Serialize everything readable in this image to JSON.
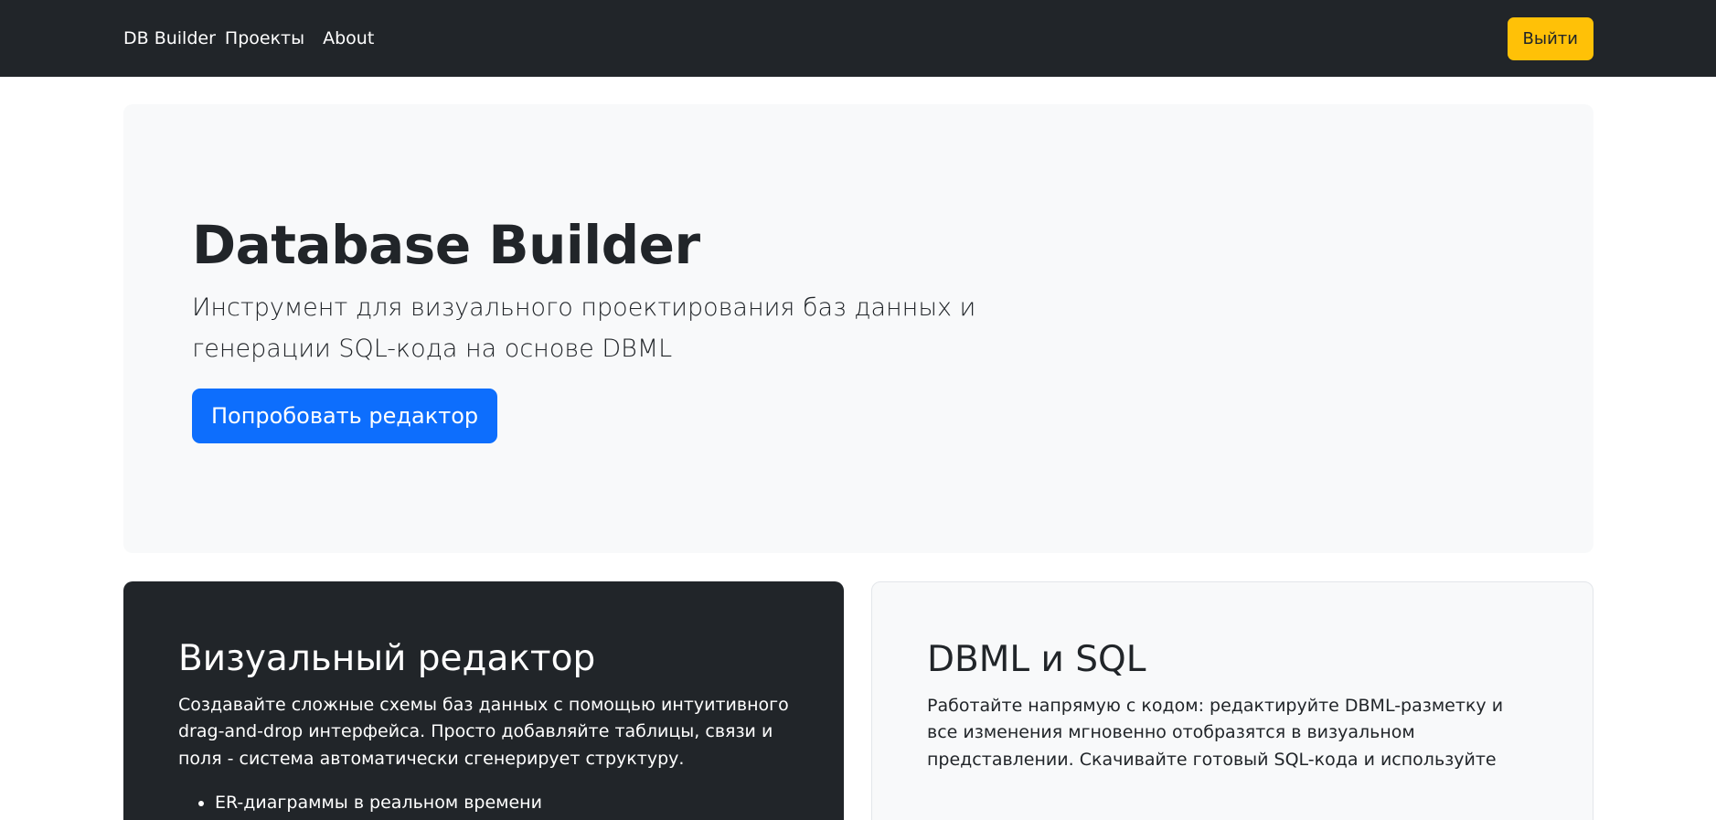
{
  "navbar": {
    "brand": "DB Builder",
    "links": [
      "Проекты",
      "About"
    ],
    "logout_label": "Выйти"
  },
  "hero": {
    "title": "Database Builder",
    "lead": "Инструмент для визуального проектирования баз данных и генерации SQL-кода на основе DBML",
    "cta_label": "Попробовать редактор"
  },
  "features": [
    {
      "title": "Визуальный редактор",
      "text": "Создавайте сложные схемы баз данных с помощью интуитивного drag-and-drop интерфейса. Просто добавляйте таблицы, связи и поля - система автоматически сгенерирует структуру.",
      "list": [
        "ER-диаграммы в реальном времени"
      ]
    },
    {
      "title": "DBML и SQL",
      "text": "Работайте напрямую с кодом: редактируйте DBML-разметку и все изменения мгновенно отобразятся в визуальном представлении. Скачивайте готовый SQL-кода и используйте"
    }
  ],
  "colors": {
    "navbar_bg": "#212529",
    "warning": "#ffc107",
    "primary": "#0d6efd",
    "hero_bg": "#f8f9fa"
  }
}
